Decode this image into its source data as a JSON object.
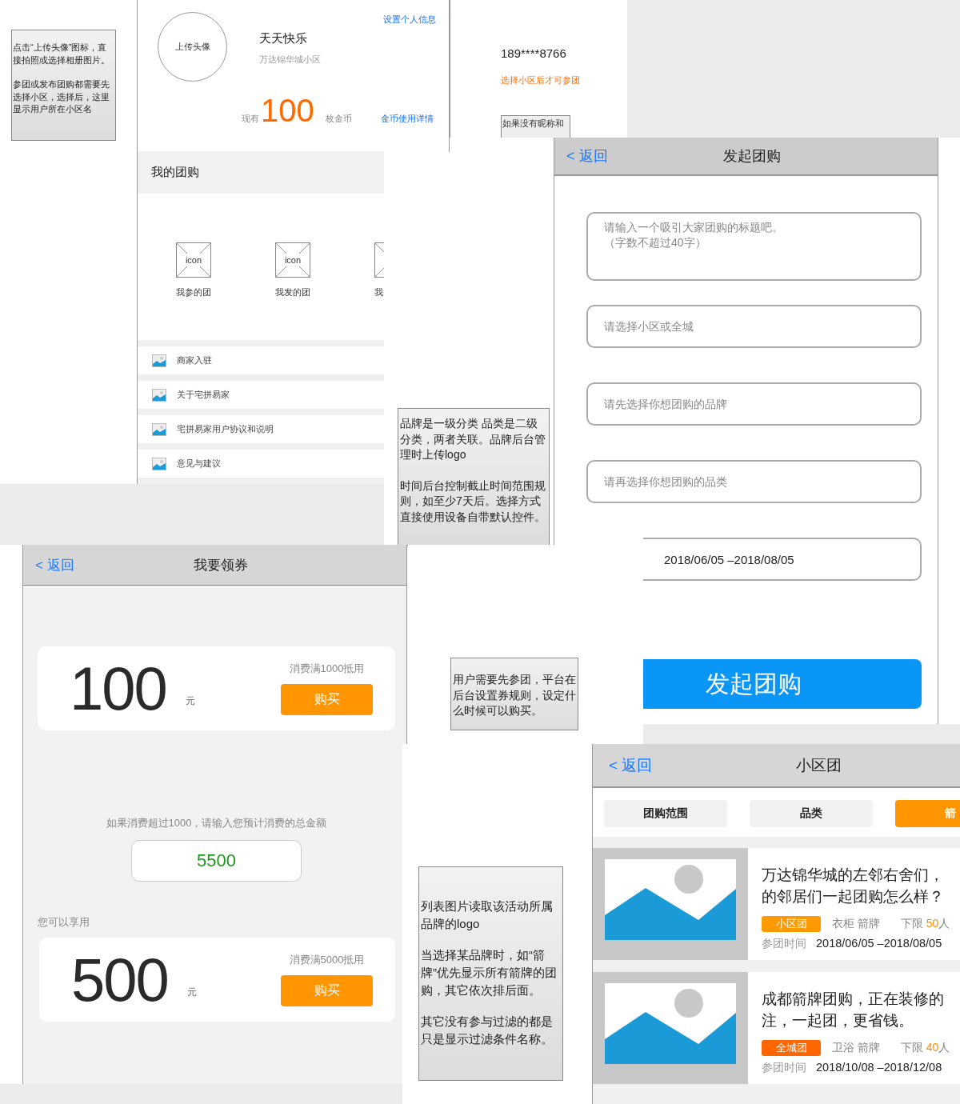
{
  "notes": [
    {
      "paragraphs": [
        "点击“上传头像”图标，直接拍照或选择相册图片。",
        "参团或发布团购都需要先选择小区，选择后，这里显示用户所在小区名"
      ]
    },
    {
      "paragraphs": [
        "品牌是一级分类  品类是二级分类，两者关联。品牌后台管理时上传logo",
        "时间后台控制截止时间范围规则，如至少7天后。选择方式直接使用设备自带默认控件。"
      ]
    },
    {
      "paragraphs": [
        "用户需要先参团，平台在后台设置券规则，设定什么时候可以购买。"
      ]
    },
    {
      "paragraphs": [
        "列表图片读取该活动所属品牌的logo",
        "当选择某品牌时，如“箭牌”优先显示所有箭牌的团购，其它依次排后面。",
        "其它没有参与过滤的都是只是显示过滤条件名称。"
      ]
    }
  ],
  "profile_screen": {
    "avatar_button": "上传头像",
    "nickname": "天天快乐",
    "community": "万达锦华城小区",
    "settings_link": "设置个人信息",
    "coins_prefix": "现有",
    "coins": "100",
    "coins_unit": "枚金币",
    "coins_link": "金币使用详情"
  },
  "my_groups": {
    "title": "我的团购",
    "shortcuts": [
      {
        "icon_text": "icon",
        "label": "我参的团"
      },
      {
        "icon_text": "icon",
        "label": "我发的团"
      },
      {
        "label": "我"
      }
    ],
    "menu": [
      "商家入驻",
      "关于宅拼易家",
      "宅拼易家用户协议和说明",
      "意见与建议"
    ]
  },
  "account_panel": {
    "phone": "189****8766",
    "hint": "选择小区后才可参团",
    "note": "如果没有昵称和"
  },
  "create_group_screen": {
    "back": "< 返回",
    "title": "发起团购",
    "fields": [
      {
        "kind": "textarea",
        "placeholder": "请输入一个吸引大家团购的标题吧。（字数不超过40字）"
      },
      {
        "kind": "select",
        "placeholder": "请选择小区或全城"
      },
      {
        "kind": "select",
        "placeholder": "请先选择你想团购的品牌"
      },
      {
        "kind": "select",
        "placeholder": "请再选择你想团购的品类"
      },
      {
        "kind": "date",
        "value": "2018/06/05 –2018/08/05"
      }
    ],
    "submit": "发起团购"
  },
  "coupon_screen": {
    "back": "< 返回",
    "title": "我要领券",
    "coupon": {
      "amount": "100",
      "unit": "元",
      "condition": "消费满1000抵用",
      "button": "购买"
    },
    "prompt": "如果消费超过1000，请输入您预计消费的总金额",
    "amount_value": "5500",
    "result_label": "您可以享用",
    "result_coupon": {
      "amount": "500",
      "unit": "元",
      "condition": "消费满5000抵用",
      "button": "购买"
    }
  },
  "community_group_screen": {
    "back": "< 返回",
    "title": "小区团",
    "filters": [
      {
        "label": "团购范围",
        "selected": false
      },
      {
        "label": "品类",
        "selected": false
      },
      {
        "label": "箭",
        "selected": true
      }
    ],
    "listings": [
      {
        "title_lines": [
          "万达锦华城的左邻右舍们，",
          "的邻居们一起团购怎么样？"
        ],
        "tag": "小区团",
        "color": "#ff9900",
        "category": "衣柜 箭牌",
        "limit_label": "下限",
        "limit_count": "50",
        "limit_unit": "人",
        "time_label": "参团时间",
        "time": "2018/06/05 –2018/08/05"
      },
      {
        "title_lines": [
          "成都箭牌团购，正在装修的",
          "注，一起团，更省钱。"
        ],
        "tag": "全城团",
        "color": "#ff6600",
        "category": "卫浴 箭牌",
        "limit_label": "下限",
        "limit_count": "40",
        "limit_unit": "人",
        "time_label": "参团时间",
        "time": "2018/10/08 –2018/12/08"
      }
    ]
  }
}
